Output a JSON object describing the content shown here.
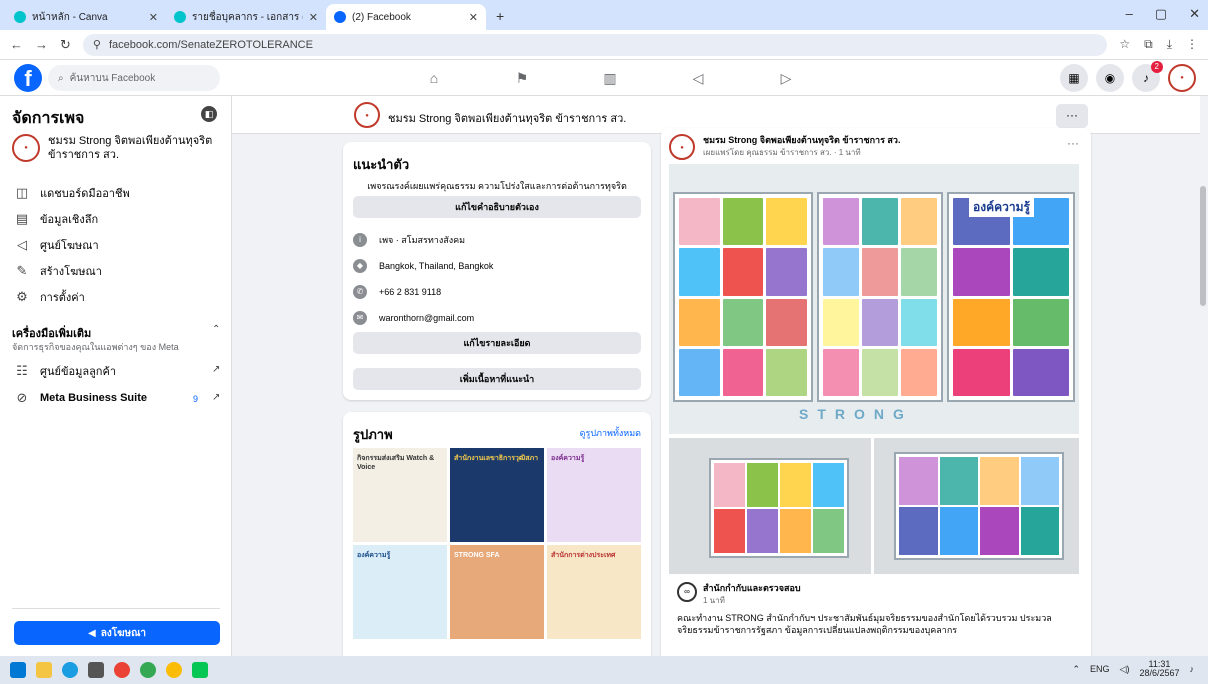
{
  "browser": {
    "tabs": [
      {
        "title": "หน้าหลัก - Canva",
        "color": "#00c4cc"
      },
      {
        "title": "รายชื่อบุคลากร - เอกสาร (A4)",
        "color": "#00c4cc"
      },
      {
        "title": "(2) Facebook",
        "color": "#0866ff"
      }
    ],
    "new_tab": "+",
    "url": "facebook.com/SenateZEROTOLERANCE"
  },
  "fb": {
    "search_placeholder": "ค้นหาบน Facebook",
    "notif_count": "2"
  },
  "sidebar": {
    "title": "จัดการเพจ",
    "page_name": "ชมรม Strong จิตพอเพียงต้านทุจริต ข้าราชการ สว.",
    "items": [
      {
        "label": "แดชบอร์ดมืออาชีพ",
        "icon": "dashboard-icon",
        "glyph": "◫"
      },
      {
        "label": "ข้อมูลเชิงลึก",
        "icon": "insights-icon",
        "glyph": "▤"
      },
      {
        "label": "ศูนย์โฆษณา",
        "icon": "megaphone-icon",
        "glyph": "◁"
      },
      {
        "label": "สร้างโฆษณา",
        "icon": "pencil-icon",
        "glyph": "✎"
      },
      {
        "label": "การตั้งค่า",
        "icon": "gear-icon",
        "glyph": "⚙"
      }
    ],
    "tools_title": "เครื่องมือเพิ่มเติม",
    "tools_sub": "จัดการธุรกิจของคุณในแอพต่างๆ ของ Meta",
    "customer_center": "ศูนย์ข้อมูลลูกค้า",
    "meta_suite": "Meta Business Suite",
    "meta_count": "9",
    "promote": "ลงโฆษณา"
  },
  "pagebar": {
    "name": "ชมรม Strong จิตพอเพียงต้านทุจริต ข้าราชการ สว."
  },
  "intro": {
    "title": "แนะนำตัว",
    "bio": "เพจรณรงค์เผยแพร่คุณธรรม ความโปร่งใสและการต่อต้านการทุจริต",
    "edit_bio": "แก้ไขคำอธิบายตัวเอง",
    "category": "เพจ · สโมสรทางสังคม",
    "location": "Bangkok, Thailand, Bangkok",
    "phone": "+66 2 831 9118",
    "email": "waronthorn@gmail.com",
    "edit_details": "แก้ไขรายละเอียด",
    "add_featured": "เพิ่มเนื้อหาที่แนะนำ"
  },
  "photos": {
    "title": "รูปภาพ",
    "see_all": "ดูรูปภาพทั้งหมด",
    "tiles": [
      {
        "label": "กิจกรรมส่งเสริม Watch & Voice",
        "bg": "#f4efe4",
        "fg": "#333"
      },
      {
        "label": "สำนักงานเลขาธิการวุฒิสภา",
        "bg": "#1b3a6b",
        "fg": "#f2c94c"
      },
      {
        "label": "องค์ความรู้",
        "bg": "#eadcf2",
        "fg": "#7b2d8e"
      },
      {
        "label": "องค์ความรู้",
        "bg": "#dbeef8",
        "fg": "#1b4f8a"
      },
      {
        "label": "STRONG SFA",
        "bg": "#e8a97a",
        "fg": "#fff"
      },
      {
        "label": "สำนักการต่างประเทศ",
        "bg": "#f7e7c6",
        "fg": "#b33"
      }
    ]
  },
  "post": {
    "author": "ชมรม Strong จิตพอเพียงต้านทุจริต ข้าราชการ สว.",
    "meta": "เผยแพร่โดย คุณธรรม ข้าราชการ สว. · 1 นาที",
    "board_heading": "องค์ความรู้",
    "strong_word": "STRONG",
    "shared_name": "สำนักกำกับและตรวจสอบ",
    "shared_time": "1 นาที",
    "text": "คณะทำงาน STRONG สำนักกำกับฯ ประชาสัมพันธ์มุมจริยธรรมของสำนักโดยได้รวบรวม ประมวลจริยธรรมข้าราชการรัฐสภา ข้อมูลการเปลี่ยนแปลงพฤติกรรมของบุคลากร"
  },
  "tray": {
    "lang": "ENG",
    "time": "11:31",
    "date": "28/6/2567"
  }
}
